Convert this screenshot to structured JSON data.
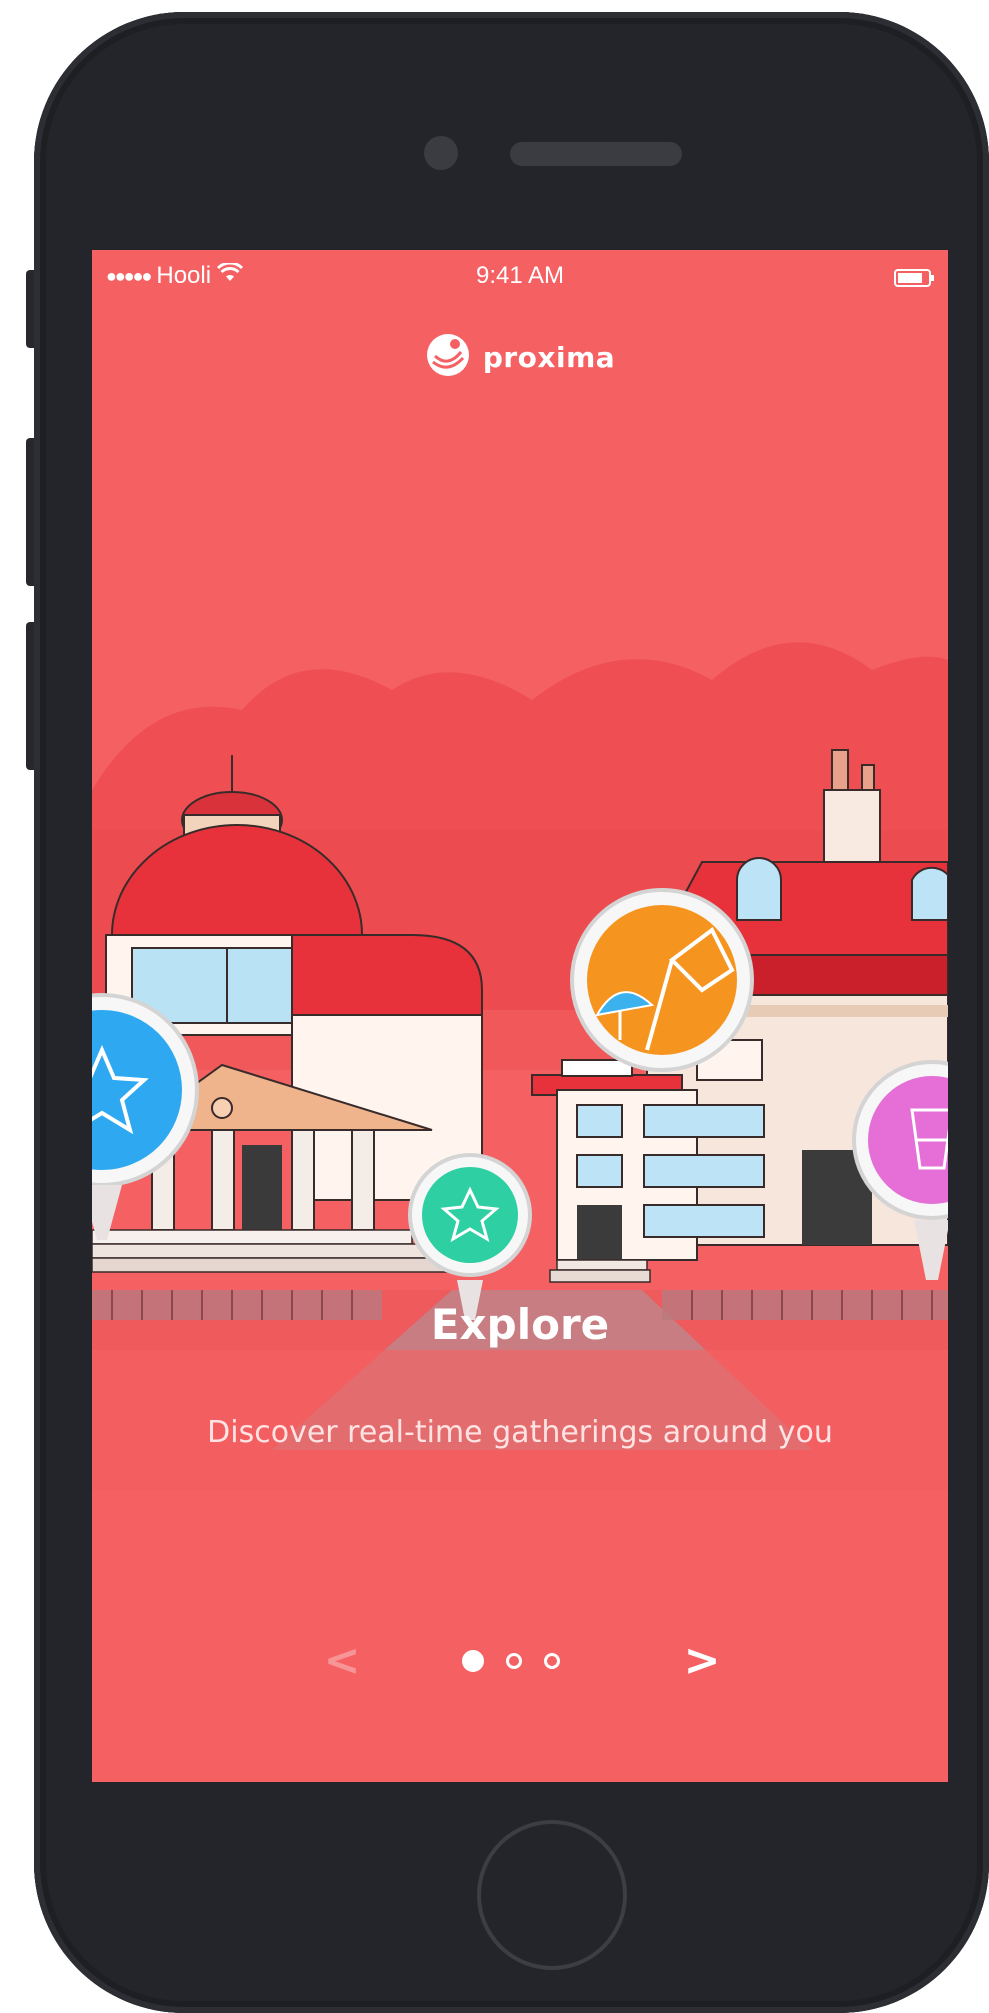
{
  "status_bar": {
    "signal": "●●●●●",
    "carrier": "Hooli",
    "time": "9:41 AM"
  },
  "app": {
    "logo_text": "proxima"
  },
  "onboarding": {
    "title": "Explore",
    "description": "Discover real-time gatherings around you",
    "prev_label": "<",
    "next_label": ">",
    "current_page": 1,
    "page_count": 3
  },
  "colors": {
    "background": "#f56163",
    "accent_blue": "#2ea8f0",
    "accent_green": "#2ecfa2",
    "accent_orange": "#f5951f",
    "accent_pink": "#e56fd6",
    "device": "#23252a"
  },
  "icons": {
    "pins": [
      "star-pin-icon",
      "beach-pin-icon",
      "star-pin-icon",
      "drink-pin-icon"
    ],
    "wifi": "wifi-icon",
    "battery": "battery-icon"
  }
}
